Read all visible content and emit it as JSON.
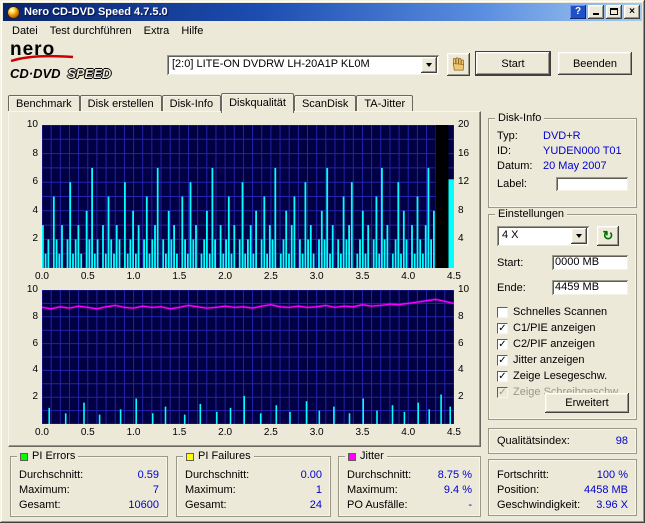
{
  "window": {
    "title": "Nero CD-DVD Speed 4.7.5.0"
  },
  "icons": {
    "help": "?",
    "close": "×",
    "check": "✓",
    "refresh": "↻",
    "dropdown": "▼"
  },
  "colors": {
    "value_text": "#0000cd",
    "chart_bg": "#000042",
    "grid": "#2323ab",
    "bar": "#00ffff",
    "jitter": "#ff00ff"
  },
  "menu": {
    "items": [
      "Datei",
      "Test durchführen",
      "Extra",
      "Hilfe"
    ]
  },
  "logo": {
    "brand": "nero",
    "product": "CD·DVD",
    "speed": "SPEED"
  },
  "toolbar": {
    "drive": "[2:0]  LITE-ON DVDRW LH-20A1P KL0M",
    "start": "Start",
    "quit": "Beenden"
  },
  "tabs": {
    "items": [
      "Benchmark",
      "Disk erstellen",
      "Disk-Info",
      "Diskqualität",
      "ScanDisk",
      "TA-Jitter"
    ],
    "active_index": 3
  },
  "disk_info": {
    "title": "Disk-Info",
    "rows": [
      {
        "label": "Typ:",
        "value": "DVD+R"
      },
      {
        "label": "ID:",
        "value": "YUDEN000 T01"
      },
      {
        "label": "Datum:",
        "value": "20 May 2007"
      }
    ],
    "label_label": "Label:",
    "label_value": ""
  },
  "settings": {
    "title": "Einstellungen",
    "speed": "4 X",
    "start_label": "Start:",
    "start_value": "0000 MB",
    "end_label": "Ende:",
    "end_value": "4459 MB",
    "advanced": "Erweitert",
    "checkboxes": [
      {
        "label": "Schnelles Scannen",
        "checked": false,
        "enabled": true
      },
      {
        "label": "C1/PIE anzeigen",
        "checked": true,
        "enabled": true
      },
      {
        "label": "C2/PIF anzeigen",
        "checked": true,
        "enabled": true
      },
      {
        "label": "Jitter anzeigen",
        "checked": true,
        "enabled": true
      },
      {
        "label": "Zeige Lesegeschw.",
        "checked": true,
        "enabled": true
      },
      {
        "label": "Zeige Schreibgeschw.",
        "checked": true,
        "enabled": false
      }
    ]
  },
  "quality": {
    "label": "Qualitätsindex:",
    "value": "98"
  },
  "progress": {
    "rows": [
      {
        "label": "Fortschritt:",
        "value": "100 %"
      },
      {
        "label": "Position:",
        "value": "4458 MB"
      },
      {
        "label": "Geschwindigkeit:",
        "value": "3.96 X"
      }
    ]
  },
  "stats": [
    {
      "title": "PI Errors",
      "color": "#00ff00",
      "rows": [
        {
          "label": "Durchschnitt:",
          "value": "0.59"
        },
        {
          "label": "Maximum:",
          "value": "7"
        },
        {
          "label": "Gesamt:",
          "value": "10600"
        }
      ]
    },
    {
      "title": "PI Failures",
      "color": "#ffff00",
      "rows": [
        {
          "label": "Durchschnitt:",
          "value": "0.00"
        },
        {
          "label": "Maximum:",
          "value": "1"
        },
        {
          "label": "Gesamt:",
          "value": "24"
        }
      ]
    },
    {
      "title": "Jitter",
      "color": "#ff00ff",
      "rows": [
        {
          "label": "Durchschnitt:",
          "value": "8.75 %"
        },
        {
          "label": "Maximum:",
          "value": "9.4 %"
        },
        {
          "label": "PO Ausfälle:",
          "value": "-"
        }
      ]
    }
  ],
  "chart_data": [
    {
      "type": "bar",
      "title": "PI Errors über Disk-Position (GB)",
      "x_ticks": [
        "0.0",
        "0.5",
        "1.0",
        "1.5",
        "2.0",
        "2.5",
        "3.0",
        "3.5",
        "4.0",
        "4.5"
      ],
      "xlim": [
        0,
        4.5
      ],
      "ylim": [
        0,
        10
      ],
      "y_left_ticks": [
        10,
        8,
        6,
        4,
        2
      ],
      "y_right_ticks": [
        20,
        16,
        12,
        8,
        4
      ],
      "bar_span": [
        0,
        4.3
      ],
      "blackout": [
        4.3,
        4.44
      ],
      "end_bar": [
        4.44,
        4.5,
        6.2
      ],
      "bar_values": [
        3,
        1,
        2,
        0,
        5,
        2,
        1,
        3,
        0,
        2,
        6,
        1,
        2,
        3,
        1,
        0,
        4,
        2,
        7,
        1,
        2,
        0,
        3,
        1,
        5,
        2,
        1,
        3,
        2,
        0,
        6,
        1,
        2,
        4,
        1,
        3,
        0,
        2,
        5,
        1,
        2,
        3,
        7,
        0,
        2,
        1,
        4,
        2,
        3,
        1,
        0,
        5,
        2,
        1,
        6,
        2,
        3,
        0,
        1,
        2,
        4,
        1,
        7,
        2,
        0,
        3,
        1,
        2,
        5,
        1,
        3,
        0,
        2,
        6,
        1,
        2,
        3,
        1,
        4,
        0,
        2,
        5,
        1,
        3,
        2,
        7,
        0,
        1,
        2,
        4,
        1,
        3,
        5,
        0,
        2,
        1,
        6,
        2,
        3,
        1,
        0,
        2,
        4,
        2,
        7,
        1,
        3,
        0,
        2,
        1,
        5,
        2,
        3,
        6,
        0,
        1,
        2,
        4,
        1,
        3,
        0,
        2,
        5,
        1,
        7,
        2,
        3,
        0,
        1,
        2,
        6,
        1,
        4,
        2,
        0,
        3,
        1,
        5,
        2,
        1,
        3,
        7,
        2,
        4
      ]
    },
    {
      "type": "line",
      "title": "Jitter und PI Failures über Disk-Position (GB)",
      "x_ticks": [
        "0.0",
        "0.5",
        "1.0",
        "1.5",
        "2.0",
        "2.5",
        "3.0",
        "3.5",
        "4.0",
        "4.5"
      ],
      "xlim": [
        0,
        4.5
      ],
      "ylim": [
        0,
        10
      ],
      "y_left_ticks": [
        10,
        8,
        6,
        4,
        2
      ],
      "y_right_ticks": [
        10,
        8,
        6,
        4,
        2
      ],
      "jitter_x_step": 0.1,
      "jitter_values": [
        8.7,
        8.6,
        8.75,
        8.65,
        8.8,
        8.7,
        8.6,
        8.75,
        8.85,
        8.7,
        8.65,
        8.8,
        8.7,
        8.75,
        8.6,
        8.7,
        8.85,
        8.75,
        8.65,
        8.7,
        8.8,
        8.7,
        8.75,
        8.65,
        8.8,
        8.9,
        8.75,
        8.7,
        8.8,
        8.7,
        8.75,
        8.85,
        8.7,
        8.8,
        8.75,
        8.9,
        8.8,
        8.85,
        8.95,
        8.9,
        9.0,
        9.1,
        9.2,
        9.3,
        9.15,
        9.0
      ],
      "spikes": [
        [
          0.07,
          1.2
        ],
        [
          0.25,
          0.8
        ],
        [
          0.45,
          1.6
        ],
        [
          0.62,
          0.7
        ],
        [
          0.85,
          1.1
        ],
        [
          1.02,
          1.9
        ],
        [
          1.2,
          0.8
        ],
        [
          1.34,
          1.3
        ],
        [
          1.55,
          0.7
        ],
        [
          1.72,
          1.5
        ],
        [
          1.9,
          0.9
        ],
        [
          2.05,
          1.2
        ],
        [
          2.2,
          2.1
        ],
        [
          2.38,
          0.8
        ],
        [
          2.55,
          1.4
        ],
        [
          2.7,
          0.9
        ],
        [
          2.88,
          1.7
        ],
        [
          3.02,
          1.0
        ],
        [
          3.18,
          1.3
        ],
        [
          3.35,
          0.8
        ],
        [
          3.5,
          1.9
        ],
        [
          3.65,
          1.0
        ],
        [
          3.82,
          1.4
        ],
        [
          3.95,
          0.9
        ],
        [
          4.1,
          1.6
        ],
        [
          4.22,
          1.1
        ],
        [
          4.35,
          2.2
        ],
        [
          4.45,
          1.3
        ]
      ]
    }
  ]
}
